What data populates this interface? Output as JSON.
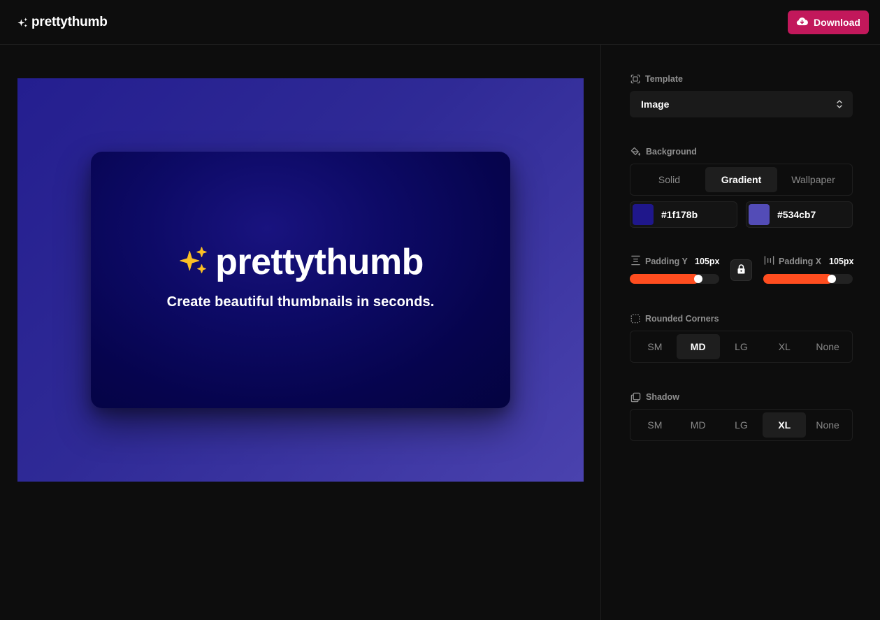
{
  "header": {
    "brand_name": "prettythumb",
    "download_label": "Download"
  },
  "preview": {
    "card_logo_name": "prettythumb",
    "card_tagline": "Create beautiful thumbnails in seconds."
  },
  "sidebar": {
    "template": {
      "label": "Template",
      "value": "Image"
    },
    "background": {
      "label": "Background",
      "options": [
        "Solid",
        "Gradient",
        "Wallpaper"
      ],
      "selected": "Gradient",
      "color_from": "#1f178b",
      "color_to": "#534cb7"
    },
    "padding": {
      "y_label": "Padding Y",
      "y_value": "105px",
      "y_level": 0.72,
      "x_label": "Padding X",
      "x_value": "105px",
      "x_level": 0.72
    },
    "rounded": {
      "label": "Rounded Corners",
      "options": [
        "SM",
        "MD",
        "LG",
        "XL",
        "None"
      ],
      "selected": "MD"
    },
    "shadow": {
      "label": "Shadow",
      "options": [
        "SM",
        "MD",
        "LG",
        "XL",
        "None"
      ],
      "selected": "XL"
    }
  },
  "colors": {
    "accent": "#c2185b",
    "slider": "#ff4d1f",
    "sparkle": "#fbbf24"
  }
}
